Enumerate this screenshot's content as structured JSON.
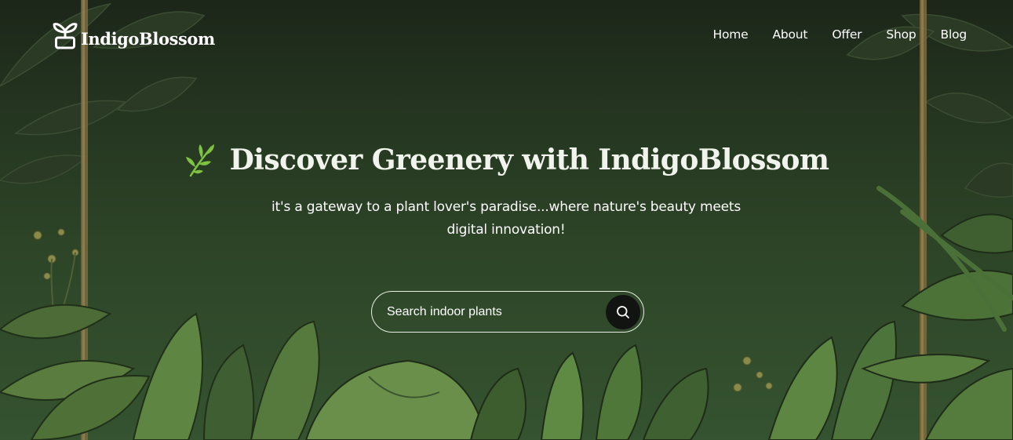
{
  "brand": {
    "name": "IndigoBlossom",
    "logo_icon": "potted-sprout-icon"
  },
  "nav": {
    "items": [
      {
        "label": "Home"
      },
      {
        "label": "About"
      },
      {
        "label": "Offer"
      },
      {
        "label": "Shop"
      },
      {
        "label": "Blog"
      }
    ]
  },
  "hero": {
    "headline_icon": "leaf-branch-icon",
    "headline": "Discover Greenery with IndigoBlossom",
    "tagline": "it's a gateway to a plant lover's paradise...where nature's beauty meets digital innovation!"
  },
  "search": {
    "placeholder": "Search indoor plants",
    "value": "",
    "button_icon": "search-icon"
  },
  "colors": {
    "background_dark": "#1c2619",
    "background_light": "#355330",
    "accent_leaf": "#7fc242",
    "text": "#ffffff",
    "search_button": "#111410"
  }
}
